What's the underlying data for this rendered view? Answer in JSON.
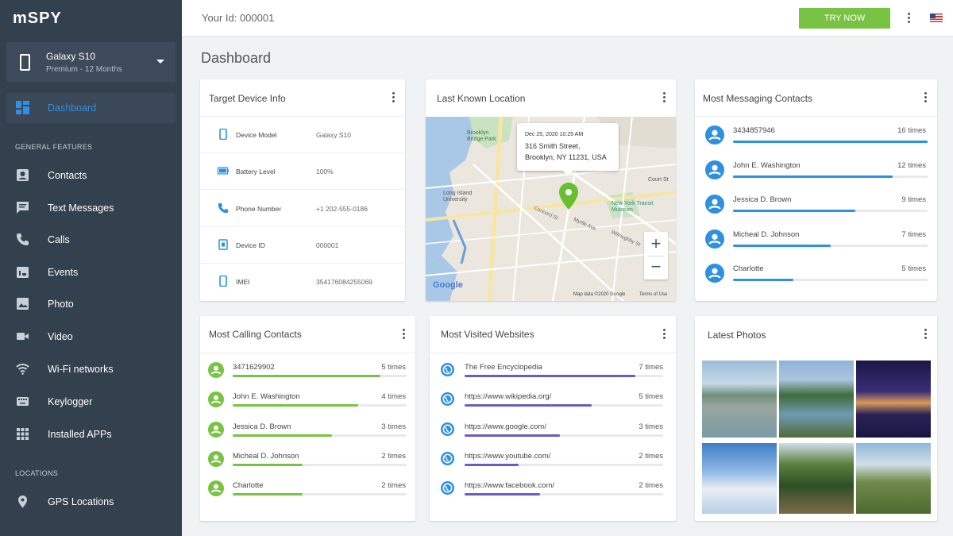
{
  "app": {
    "logo": "mSPY"
  },
  "device": {
    "name": "Galaxy S10",
    "plan": "Premium - 12 Months"
  },
  "sidebar": {
    "active": "Dashboard",
    "section_general": "GENERAL FEATURES",
    "section_locations": "LOCATIONS",
    "items": [
      {
        "label": "Dashboard",
        "icon": "dashboard-icon"
      },
      {
        "label": "Contacts",
        "icon": "contacts-icon"
      },
      {
        "label": "Text Messages",
        "icon": "message-icon"
      },
      {
        "label": "Calls",
        "icon": "phone-icon"
      },
      {
        "label": "Events",
        "icon": "calendar-icon"
      },
      {
        "label": "Photo",
        "icon": "photo-icon"
      },
      {
        "label": "Video",
        "icon": "video-icon"
      },
      {
        "label": "Wi-Fi networks",
        "icon": "wifi-icon"
      },
      {
        "label": "Keylogger",
        "icon": "keyboard-icon"
      },
      {
        "label": "Installed APPs",
        "icon": "apps-grid-icon"
      },
      {
        "label": "GPS Locations",
        "icon": "location-pin-icon"
      }
    ]
  },
  "topbar": {
    "your_id": "Your Id: 000001",
    "try_now": "TRY NOW"
  },
  "page": {
    "title": "Dashboard"
  },
  "target_device": {
    "title": "Target Device Info",
    "rows": [
      {
        "key": "Device Model",
        "value": "Galaxy S10",
        "icon": "smartphone-icon"
      },
      {
        "key": "Battery Level",
        "value": "100%",
        "icon": "battery-icon"
      },
      {
        "key": "Phone Number",
        "value": "+1 202-555-0186",
        "icon": "phone-icon"
      },
      {
        "key": "Device ID",
        "value": "000001",
        "icon": "device-id-icon"
      },
      {
        "key": "IMEI",
        "value": "354176084255069",
        "icon": "smartphone-icon"
      }
    ]
  },
  "location": {
    "title": "Last Known Location",
    "date": "Dec 25, 2020 10:25 AM",
    "address_line1": "316 Smith Street,",
    "address_line2": "Brooklyn, NY 11231, USA",
    "labels": {
      "bridge": "Brooklyn Bridge Park",
      "university": "Long Island University",
      "museum": "New York Transit Museum",
      "court": "Court St",
      "street1": "Concord St",
      "street2": "Myrtle Ave",
      "street3": "Willoughby St"
    },
    "google": "Google",
    "map_data": "Map data ©2020 Google",
    "terms": "Terms of Use",
    "zoom_in": "+",
    "zoom_out": "−"
  },
  "messaging": {
    "title": "Most Messaging Contacts",
    "color": "#2f8fe0",
    "items": [
      {
        "name": "3434857946",
        "count": "16 times",
        "ratio": 1.0
      },
      {
        "name": "John E. Washington",
        "count": "12 times",
        "ratio": 0.82
      },
      {
        "name": "Jessica D. Brown",
        "count": "9 times",
        "ratio": 0.63
      },
      {
        "name": "Micheal D. Johnson",
        "count": "7 times",
        "ratio": 0.5
      },
      {
        "name": "Charlotte",
        "count": "5 times",
        "ratio": 0.31
      }
    ]
  },
  "calling": {
    "title": "Most Calling Contacts",
    "color": "#79c344",
    "items": [
      {
        "name": "3471629902",
        "count": "5 times",
        "ratio": 0.85
      },
      {
        "name": "John E. Washington",
        "count": "4 times",
        "ratio": 0.72
      },
      {
        "name": "Jessica D. Brown",
        "count": "3 times",
        "ratio": 0.57
      },
      {
        "name": "Micheal D. Johnson",
        "count": "2 times",
        "ratio": 0.4
      },
      {
        "name": "Charlotte",
        "count": "2 times",
        "ratio": 0.4
      }
    ]
  },
  "websites": {
    "title": "Most Visited Websites",
    "color": "#6a5cc8",
    "items": [
      {
        "name": "The Free Encyclopedia",
        "count": "7 times",
        "ratio": 0.86
      },
      {
        "name": "https://www.wikipedia.org/",
        "count": "5 times",
        "ratio": 0.64
      },
      {
        "name": "https://www.google.com/",
        "count": "3 times",
        "ratio": 0.48
      },
      {
        "name": "https://www.youtube.com/",
        "count": "2 times",
        "ratio": 0.27
      },
      {
        "name": "https://www.facebook.com/",
        "count": "2 times",
        "ratio": 0.38
      }
    ]
  },
  "photos": {
    "title": "Latest Photos",
    "items": [
      "mountain-lake",
      "forest-lake",
      "night-bridge",
      "sky-clouds",
      "forest-path",
      "green-valley"
    ]
  }
}
